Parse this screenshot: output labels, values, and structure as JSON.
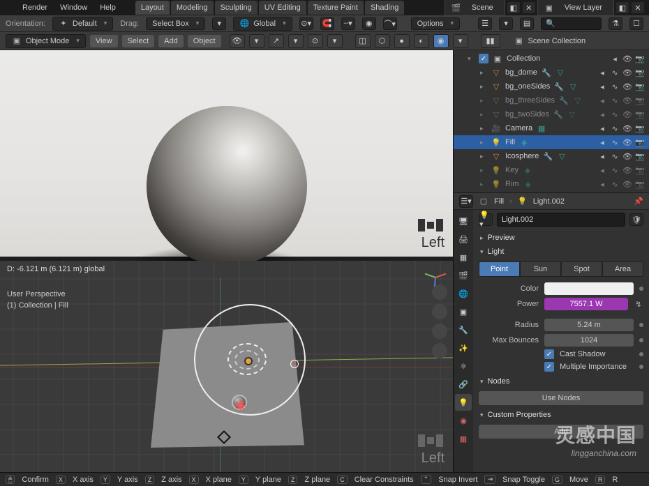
{
  "menu": {
    "render": "Render",
    "window": "Window",
    "help": "Help"
  },
  "workspaces": [
    "Layout",
    "Modeling",
    "Sculpting",
    "UV Editing",
    "Texture Paint",
    "Shading"
  ],
  "scene": {
    "label": "Scene",
    "layer": "View Layer"
  },
  "header": {
    "orientation_label": "Orientation:",
    "orientation": "Default",
    "drag_label": "Drag:",
    "drag": "Select Box",
    "transform": "Global",
    "options": "Options"
  },
  "tool": {
    "mode": "Object Mode",
    "view": "View",
    "select": "Select",
    "add": "Add",
    "object": "Object"
  },
  "outliner": {
    "root": "Scene Collection",
    "collection": "Collection",
    "items": [
      {
        "name": "bg_dome",
        "type": "mesh"
      },
      {
        "name": "bg_oneSides",
        "type": "mesh",
        "hl": true
      },
      {
        "name": "bg_threeSides",
        "type": "mesh",
        "dim": true
      },
      {
        "name": "bg_twoSides",
        "type": "mesh",
        "dim": true
      },
      {
        "name": "Camera",
        "type": "camera"
      },
      {
        "name": "Fill",
        "type": "light",
        "sel": true
      },
      {
        "name": "Icosphere",
        "type": "mesh"
      },
      {
        "name": "Key",
        "type": "light",
        "dim": true
      },
      {
        "name": "Rim",
        "type": "light",
        "dim": true
      }
    ]
  },
  "props": {
    "crumb_obj": "Fill",
    "crumb_data": "Light.002",
    "name": "Light.002",
    "preview": "Preview",
    "light_hdr": "Light",
    "types": {
      "point": "Point",
      "sun": "Sun",
      "spot": "Spot",
      "area": "Area"
    },
    "color_label": "Color",
    "power_label": "Power",
    "power": "7557.1 W",
    "radius_label": "Radius",
    "radius": "5.24 m",
    "bounces_label": "Max Bounces",
    "bounces": "1024",
    "cast_shadow": "Cast Shadow",
    "multi_imp": "Multiple Importance",
    "nodes_hdr": "Nodes",
    "use_nodes": "Use Nodes",
    "custom_hdr": "Custom Properties",
    "add": "Add"
  },
  "viewport": {
    "status": "D: -6.121 m (6.121 m) global",
    "persp": "User Perspective",
    "path": "(1) Collection | Fill",
    "left": "Left"
  },
  "render_label": "Left",
  "status_bar": {
    "confirm": "Confirm",
    "x": "X axis",
    "y": "Y axis",
    "z": "Z axis",
    "xp": "X plane",
    "yp": "Y plane",
    "zp": "Z plane",
    "cc": "Clear Constraints",
    "si": "Snap Invert",
    "st": "Snap Toggle",
    "mv": "Move",
    "r": "R"
  },
  "watermark": {
    "cn": "灵感中国",
    "en": "lingganchina.com"
  }
}
